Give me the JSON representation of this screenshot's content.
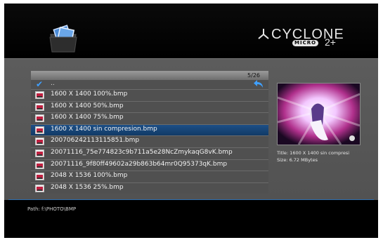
{
  "brand": {
    "name": "CYCLONE",
    "sub": "MICRO",
    "plus": "2+"
  },
  "list": {
    "counter": "5/26",
    "up_label": "..",
    "files": [
      {
        "name": "1600 X 1400 100%.bmp",
        "selected": false
      },
      {
        "name": "1600 X 1400 50%.bmp",
        "selected": false
      },
      {
        "name": "1600 X 1400 75%.bmp",
        "selected": false
      },
      {
        "name": "1600 X 1400 sin compresion.bmp",
        "selected": true
      },
      {
        "name": "200706242113115851.bmp",
        "selected": false
      },
      {
        "name": "20071116_75e774823c9b711a5e28NcZmykaqG8vK.bmp",
        "selected": false
      },
      {
        "name": "20071116_9f80ff49602a29b863b64mr0Q95373qK.bmp",
        "selected": false
      },
      {
        "name": "2048 X 1536 100%.bmp",
        "selected": false
      },
      {
        "name": "2048 X 1536 25%.bmp",
        "selected": false
      }
    ]
  },
  "info": {
    "title": "Title: 1600 X 1400 sin compresi",
    "size": "Size: 6.72 MBytes"
  },
  "footer": {
    "path": "Path: f:\\PHOTO\\BMP"
  },
  "colors": {
    "selection": "#1d4f86",
    "accent": "#3fa0ff",
    "panel": "#555555"
  }
}
